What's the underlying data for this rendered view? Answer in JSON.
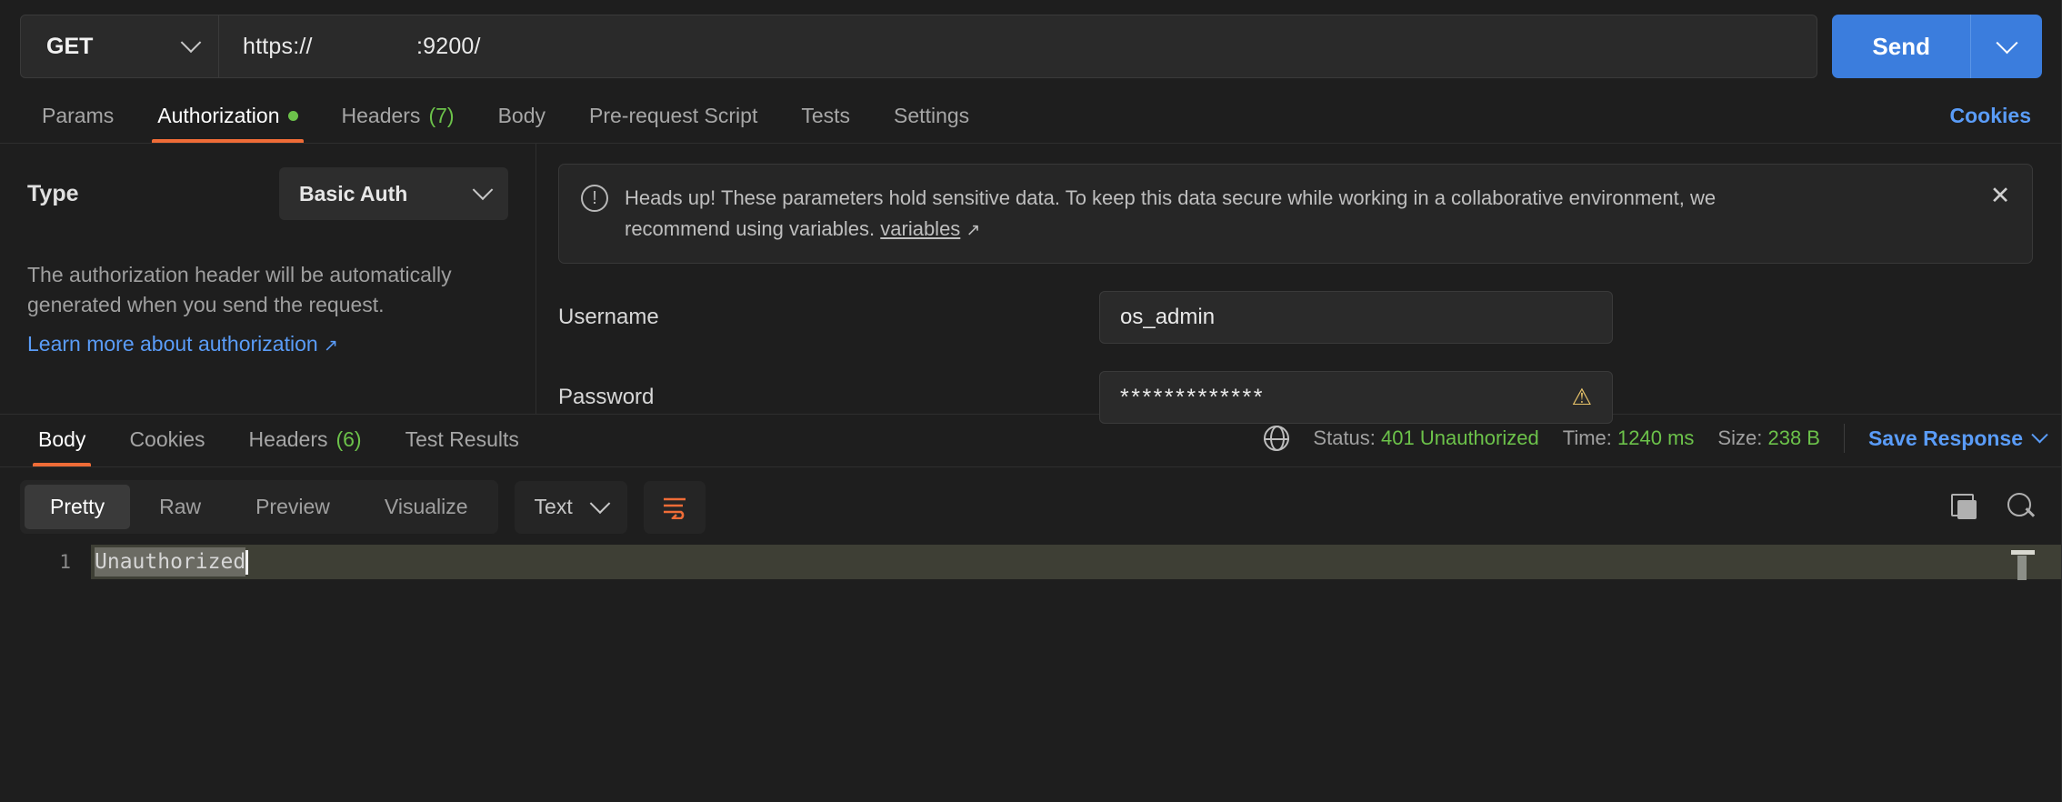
{
  "request": {
    "method": "GET",
    "url": "https://                :9200/",
    "send_label": "Send",
    "send_caret_icon": "chevron-down-icon",
    "method_caret_icon": "chevron-down-icon"
  },
  "request_tabs": [
    {
      "label": "Params",
      "active": false,
      "badge": "",
      "dot": false
    },
    {
      "label": "Authorization",
      "active": true,
      "badge": "",
      "dot": true
    },
    {
      "label": "Headers",
      "active": false,
      "badge": "(7)",
      "dot": false
    },
    {
      "label": "Body",
      "active": false,
      "badge": "",
      "dot": false
    },
    {
      "label": "Pre-request Script",
      "active": false,
      "badge": "",
      "dot": false
    },
    {
      "label": "Tests",
      "active": false,
      "badge": "",
      "dot": false
    },
    {
      "label": "Settings",
      "active": false,
      "badge": "",
      "dot": false
    }
  ],
  "cookies_link": "Cookies",
  "auth": {
    "type_label": "Type",
    "type_value": "Basic Auth",
    "type_caret_icon": "chevron-down-icon",
    "description": "The authorization header will be automatically generated when you send the request.",
    "learn_link": "Learn more about authorization",
    "external_arrow": "↗",
    "banner": {
      "icon": "info-circle-icon",
      "text": "Heads up! These parameters hold sensitive data. To keep this data secure while working in a collaborative environment, we recommend using variables.",
      "link_text": "variables",
      "close_icon": "close-icon",
      "close_glyph": "✕"
    },
    "username_label": "Username",
    "username_value": "os_admin",
    "password_label": "Password",
    "password_value": "*************",
    "password_warning_icon": "warning-triangle-icon",
    "password_warning_glyph": "⚠"
  },
  "response": {
    "tabs": [
      {
        "label": "Body",
        "active": true,
        "badge": ""
      },
      {
        "label": "Cookies",
        "active": false,
        "badge": ""
      },
      {
        "label": "Headers",
        "active": false,
        "badge": "(6)"
      },
      {
        "label": "Test Results",
        "active": false,
        "badge": ""
      }
    ],
    "globe_icon": "globe-icon",
    "status_label": "Status:",
    "status_value": "401 Unauthorized",
    "time_label": "Time:",
    "time_value": "1240 ms",
    "size_label": "Size:",
    "size_value": "238 B",
    "save_response_label": "Save Response",
    "save_response_caret_icon": "chevron-down-icon",
    "view_modes": [
      {
        "label": "Pretty",
        "active": true
      },
      {
        "label": "Raw",
        "active": false
      },
      {
        "label": "Preview",
        "active": false
      },
      {
        "label": "Visualize",
        "active": false
      }
    ],
    "format_value": "Text",
    "format_caret_icon": "chevron-down-icon",
    "wrap_icon": "word-wrap-icon",
    "copy_icon": "copy-icon",
    "search_icon": "search-icon",
    "body_lines": [
      {
        "number": "1",
        "text": "Unauthorized"
      }
    ]
  },
  "colors": {
    "accent_orange": "#ef6c37",
    "link_blue": "#5a9cf8",
    "send_blue": "#3b7ddd",
    "status_green": "#6cc24a",
    "warning_yellow": "#e9c46a",
    "background": "#1e1e1e"
  }
}
